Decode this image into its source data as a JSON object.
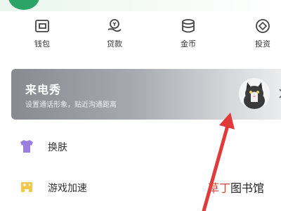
{
  "quick_actions": [
    {
      "label": "钱包",
      "icon": "wallet-icon"
    },
    {
      "label": "贷款",
      "icon": "loan-icon"
    },
    {
      "label": "金币",
      "icon": "coins-icon"
    },
    {
      "label": "投资",
      "icon": "invest-icon"
    }
  ],
  "banner": {
    "title": "来电秀",
    "subtitle": "设置通话形象，贴近沟通距离",
    "avatar": "cat-avatar-icon"
  },
  "menu": [
    {
      "label": "换肤",
      "icon": "tshirt-icon",
      "color": "#9b7fe0"
    },
    {
      "label": "游戏加速",
      "icon": "gamepad-icon",
      "color": "#f2c94c"
    }
  ],
  "watermark": {
    "accent": "草丁",
    "rest": "图书馆"
  },
  "colors": {
    "accent_green": "#2ba567",
    "arrow_red": "#e03a3a"
  }
}
